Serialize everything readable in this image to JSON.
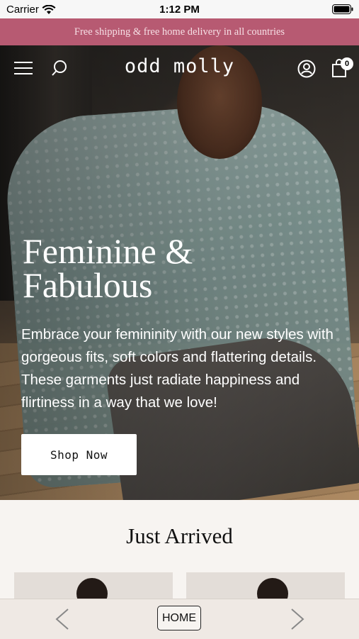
{
  "status_bar": {
    "carrier": "Carrier",
    "time": "1:12 PM"
  },
  "promo": {
    "text": "Free shipping & free home delivery in all countries"
  },
  "header": {
    "logo": "odd molly",
    "bag_count": "0"
  },
  "hero": {
    "title": "Feminine & Fabulous",
    "description": "Embrace your femininity with our new styles with gorgeous fits, soft colors and flattering details. These garments just radiate happiness and flirtiness in a way that we love!",
    "cta_label": "Shop Now"
  },
  "section": {
    "title": "Just Arrived"
  },
  "bottom_nav": {
    "home_label": "HOME"
  },
  "colors": {
    "promo_bg": "#b75a72",
    "promo_text": "#f6dfe5",
    "page_bg": "#f7f4f1"
  },
  "icons": [
    "wifi-icon",
    "battery-icon",
    "menu-icon",
    "search-icon",
    "account-icon",
    "bag-icon",
    "chevron-left-icon",
    "chevron-right-icon"
  ]
}
